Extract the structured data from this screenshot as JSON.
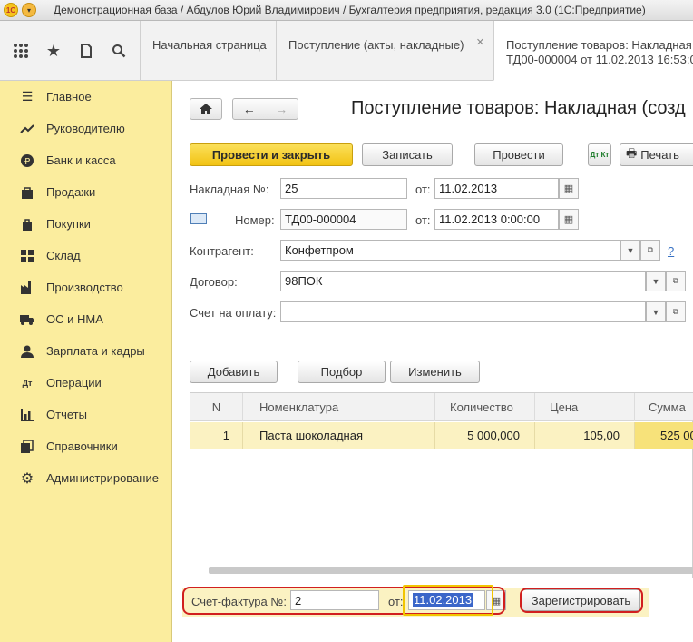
{
  "window": {
    "title": "Демонстрационная база / Абдулов Юрий Владимирович / Бухгалтерия предприятия, редакция 3.0  (1С:Предприятие)",
    "logo_text": "1С"
  },
  "tabs": [
    {
      "label": "Начальная страница"
    },
    {
      "label": "Поступление (акты, накладные)"
    },
    {
      "label": "Поступление товаров: Накладная",
      "label2": "ТД00-000004 от 11.02.2013 16:53:0"
    }
  ],
  "sidebar": {
    "items": [
      {
        "label": "Главное",
        "icon": "menu-icon"
      },
      {
        "label": "Руководителю",
        "icon": "chart-trend-icon"
      },
      {
        "label": "Банк и касса",
        "icon": "ruble-icon"
      },
      {
        "label": "Продажи",
        "icon": "bag-icon"
      },
      {
        "label": "Покупки",
        "icon": "cart-icon"
      },
      {
        "label": "Склад",
        "icon": "warehouse-icon"
      },
      {
        "label": "Производство",
        "icon": "factory-icon"
      },
      {
        "label": "ОС и НМА",
        "icon": "truck-icon"
      },
      {
        "label": "Зарплата и кадры",
        "icon": "people-icon"
      },
      {
        "label": "Операции",
        "icon": "debit-credit-icon"
      },
      {
        "label": "Отчеты",
        "icon": "bar-chart-icon"
      },
      {
        "label": "Справочники",
        "icon": "books-icon"
      },
      {
        "label": "Администрирование",
        "icon": "gear-icon"
      }
    ]
  },
  "form": {
    "title": "Поступление товаров: Накладная (созд",
    "toolbar": {
      "post_close": "Провести и закрыть",
      "save": "Записать",
      "post": "Провести",
      "dt_kt": "Дт Кт",
      "print": "Печать"
    },
    "fields": {
      "invoice_no_label": "Накладная №:",
      "invoice_no": "25",
      "from_label": "от:",
      "invoice_date": "11.02.2013",
      "number_label": "Номер:",
      "number": "ТД00-000004",
      "number_date": "11.02.2013  0:00:00",
      "counterparty_label": "Контрагент:",
      "counterparty": "Конфетпром",
      "help": "?",
      "contract_label": "Договор:",
      "contract": "98ПОК",
      "payment_account_label": "Счет на оплату:",
      "payment_account": ""
    },
    "table_toolbar": {
      "add": "Добавить",
      "pick": "Подбор",
      "change": "Изменить"
    },
    "table": {
      "columns": [
        "N",
        "Номенклатура",
        "Количество",
        "Цена",
        "Сумма"
      ],
      "rows": [
        {
          "n": "1",
          "item": "Паста шоколадная",
          "qty": "5 000,000",
          "price": "105,00",
          "sum": "525 00"
        }
      ]
    },
    "invoice": {
      "label": "Счет-фактура №:",
      "number": "2",
      "from_label": "от:",
      "date": "11.02.2013",
      "register": "Зарегистрировать"
    }
  }
}
